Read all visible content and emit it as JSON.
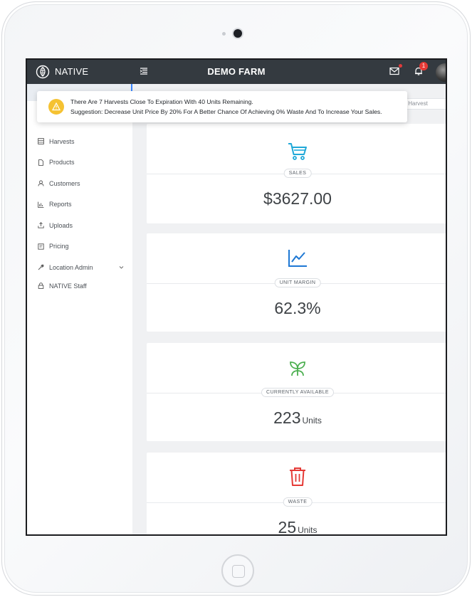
{
  "header": {
    "brand": "NATIVE",
    "farm_title": "DEMO FARM",
    "notification_count": "1"
  },
  "alert": {
    "line1": "There Are 7 Harvests Close To Expiration With 40 Units Remaining.",
    "line2": "Suggestion: Decrease Unit Price By 20% For A Better Chance Of Achieving 0% Waste And To Increase Your Sales.",
    "accent": "#f5c232"
  },
  "search": {
    "placeholder_fragment": "y Harvest"
  },
  "sidebar": {
    "items": [
      {
        "label": "Harvests",
        "icon": "list-icon"
      },
      {
        "label": "Products",
        "icon": "file-icon"
      },
      {
        "label": "Customers",
        "icon": "user-icon"
      },
      {
        "label": "Reports",
        "icon": "bar-chart-icon"
      },
      {
        "label": "Uploads",
        "icon": "upload-icon"
      },
      {
        "label": "Pricing",
        "icon": "tag-icon"
      },
      {
        "label": "Location Admin",
        "icon": "wrench-icon"
      },
      {
        "label": "NATIVE Staff",
        "icon": "lock-icon"
      }
    ]
  },
  "cards": {
    "sales": {
      "label": "SALES",
      "value": "$3627.00",
      "unit": "",
      "icon": "cart-icon",
      "color": "#1fa8d8"
    },
    "margin": {
      "label": "UNIT MARGIN",
      "value": "62.3%",
      "unit": "",
      "icon": "line-chart-icon",
      "color": "#1e78d4"
    },
    "available": {
      "label": "CURRENTLY AVAILABLE",
      "value": "223",
      "unit": "Units",
      "icon": "sprout-icon",
      "color": "#4caf50"
    },
    "waste": {
      "label": "WASTE",
      "value": "25",
      "unit": "Units",
      "icon": "trash-icon",
      "color": "#e53935"
    }
  }
}
